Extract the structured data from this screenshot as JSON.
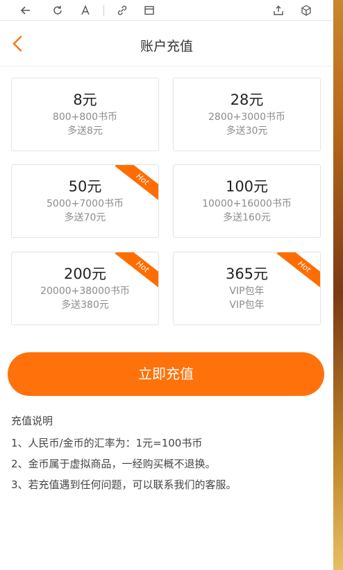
{
  "header": {
    "title": "账户充值"
  },
  "packages": [
    {
      "price": "8元",
      "coins": "800+800书币",
      "bonus": "多送8元",
      "hot": false
    },
    {
      "price": "28元",
      "coins": "2800+3000书币",
      "bonus": "多送30元",
      "hot": false
    },
    {
      "price": "50元",
      "coins": "5000+7000书币",
      "bonus": "多送70元",
      "hot": true
    },
    {
      "price": "100元",
      "coins": "10000+16000书币",
      "bonus": "多送160元",
      "hot": false
    },
    {
      "price": "200元",
      "coins": "20000+38000书币",
      "bonus": "多送380元",
      "hot": true
    },
    {
      "price": "365元",
      "coins": "VIP包年",
      "bonus": "VIP包年",
      "hot": true
    }
  ],
  "hot_label": "Hot",
  "recharge_button": "立即充值",
  "notes": {
    "title": "充值说明",
    "items": [
      "1、人民币/金币的汇率为：1元=100书币",
      "2、金币属于虚拟商品，一经购买概不退换。",
      "3、若充值遇到任何问题，可以联系我们的客服。"
    ]
  },
  "colors": {
    "accent": "#ff720b",
    "hot_badge": "#ff6d00",
    "back_arrow": "#ff720b"
  }
}
